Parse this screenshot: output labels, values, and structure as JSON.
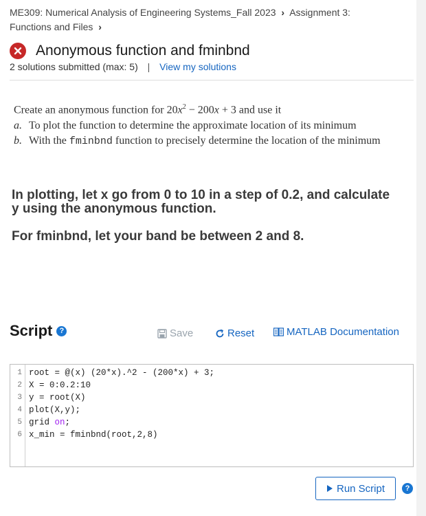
{
  "breadcrumb": {
    "course": "ME309: Numerical Analysis of Engineering Systems_Fall 2023",
    "assignment": "Assignment 3:",
    "chapter": "Functions and Files"
  },
  "problem": {
    "title": "Anonymous function and fminbnd",
    "submissions": "2 solutions submitted (max: 5)",
    "divider": "|",
    "view_link": "View my solutions"
  },
  "description": {
    "intro_start": "Create an anonymous function for 20",
    "intro_x": "x",
    "intro_exp": "2",
    "intro_mid": " − 200",
    "intro_x2": "x",
    "intro_end": " + 3 and use it",
    "item_a_mark": "a.",
    "item_a": "To plot the function to determine the approximate location of its minimum",
    "item_b_mark": "b.",
    "item_b_pre": "With the ",
    "item_b_code": "fminbnd",
    "item_b_post": " function to precisely determine the location of the minimum"
  },
  "instructions": {
    "plotting": "In plotting, let x go from 0 to 10 in a step of 0.2, and calculate y using the anonymous function.",
    "fminbnd": "For fminbnd, let your band be between 2 and 8."
  },
  "script": {
    "title": "Script",
    "help": "?",
    "save_label": "Save",
    "reset_label": "Reset",
    "doc_label": "MATLAB Documentation",
    "line_numbers": [
      "1",
      "2",
      "3",
      "4",
      "5",
      "6"
    ],
    "lines": [
      "root = @(x) (20*x).^2 - (200*x) + 3;",
      "X = 0:0.2:10",
      "y = root(X)",
      "plot(X,y);",
      "grid ",
      "x_min = fminbnd(root,2,8)"
    ],
    "line5_keyword": "on",
    "line5_tail": ";"
  },
  "run": {
    "label": "Run Script",
    "help": "?"
  },
  "colors": {
    "link": "#1565c0",
    "error": "#c62828",
    "keyword": "#a020f0",
    "disabled": "#9aa4ad"
  }
}
